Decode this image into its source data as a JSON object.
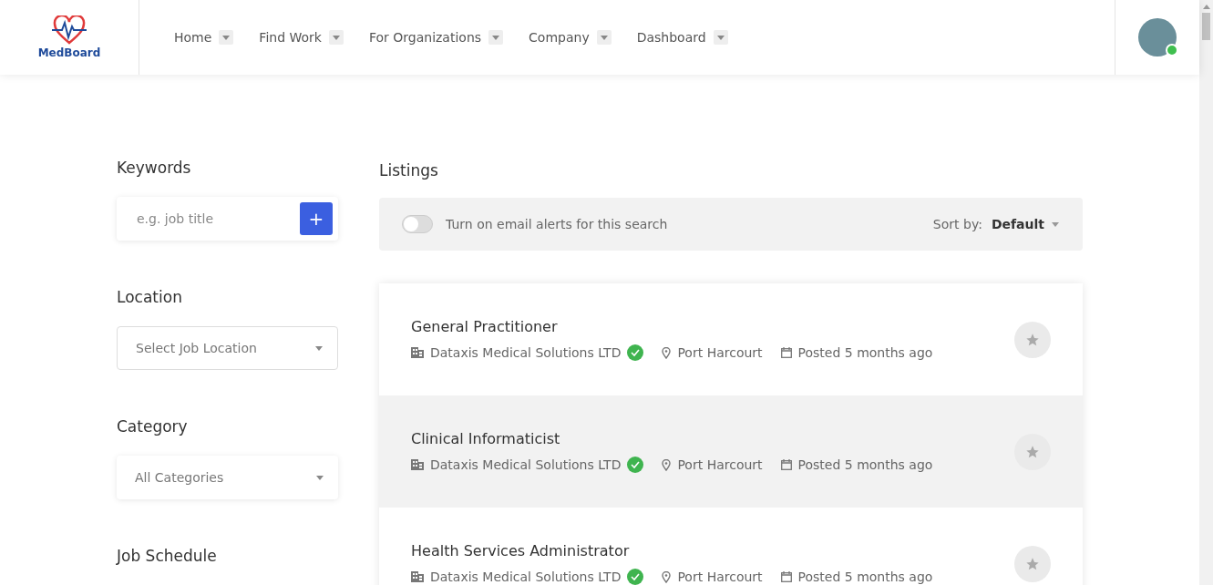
{
  "header": {
    "logo": "MedBoard",
    "nav": [
      {
        "label": "Home"
      },
      {
        "label": "Find Work"
      },
      {
        "label": "For Organizations"
      },
      {
        "label": "Company"
      },
      {
        "label": "Dashboard"
      }
    ],
    "user": {
      "online": true
    }
  },
  "sidebar": {
    "sections": [
      {
        "kind": "search",
        "title": "Keywords",
        "placeholder": "e.g. job title",
        "button": "+"
      },
      {
        "kind": "select",
        "title": "Location",
        "placeholder": "Select Job Location",
        "bordered": true
      },
      {
        "kind": "select",
        "title": "Category",
        "placeholder": "All Categories",
        "bordered": false
      },
      {
        "kind": "heading",
        "title": "Job Schedule"
      }
    ]
  },
  "listings": {
    "title": "Listings",
    "alerts": {
      "label": "Turn on email alerts for this search",
      "on": false
    },
    "sort": {
      "label": "Sort by:",
      "value": "Default"
    },
    "items": [
      {
        "title": "General Practitioner",
        "company": "Dataxis Medical Solutions LTD",
        "verified": true,
        "location": "Port Harcourt",
        "posted": "Posted 5 months ago",
        "highlighted": false,
        "starred": false
      },
      {
        "title": "Clinical Informaticist",
        "company": "Dataxis Medical Solutions LTD",
        "verified": true,
        "location": "Port Harcourt",
        "posted": "Posted 5 months ago",
        "highlighted": true,
        "starred": false
      },
      {
        "title": "Health Services Administrator",
        "company": "Dataxis Medical Solutions LTD",
        "verified": true,
        "location": "Port Harcourt",
        "posted": "Posted 5 months ago",
        "highlighted": false,
        "starred": false
      }
    ]
  }
}
